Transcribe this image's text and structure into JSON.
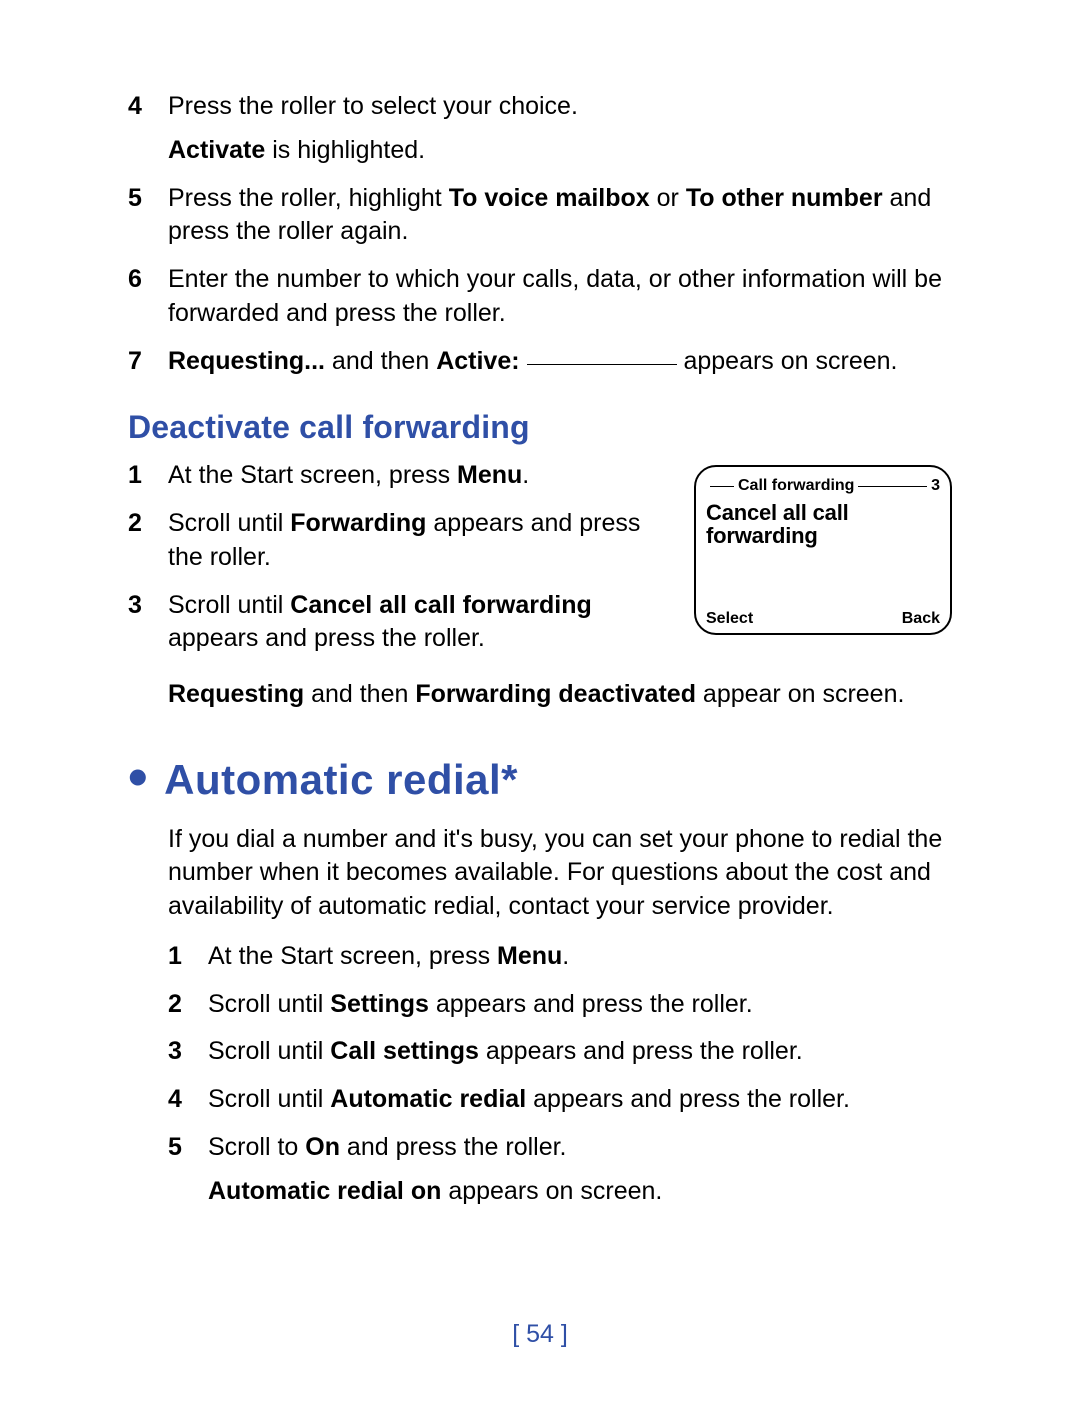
{
  "top_steps": [
    {
      "num": "4",
      "parts": [
        {
          "t": "Press the roller to select your choice."
        },
        {
          "t": "<b>Activate</b> is highlighted."
        }
      ]
    },
    {
      "num": "5",
      "parts": [
        {
          "t": "Press the roller, highlight <b>To voice mailbox</b> or <b>To other number</b> and press the roller again."
        }
      ]
    },
    {
      "num": "6",
      "parts": [
        {
          "t": "Enter the number to which your calls, data, or other information will be forwarded and press the roller."
        }
      ]
    },
    {
      "num": "7",
      "parts": [
        {
          "t": "<b>Requesting...</b> and then <b>Active:</b> <span class=\"blank\"></span> appears on screen."
        }
      ],
      "num_bold": true
    }
  ],
  "deactivate": {
    "heading": "Deactivate call forwarding",
    "steps": [
      {
        "num": "1",
        "parts": [
          {
            "t": "At the Start screen, press <b>Menu</b>."
          }
        ]
      },
      {
        "num": "2",
        "parts": [
          {
            "t": "Scroll until <b>Forwarding</b> appears and press the roller."
          }
        ]
      },
      {
        "num": "3",
        "parts": [
          {
            "t": "Scroll until <b>Cancel all call forwarding</b> appears and press the roller."
          }
        ]
      }
    ],
    "outro": "<b>Requesting</b> and then <b>Forwarding deactivated</b> appear on screen."
  },
  "phone": {
    "header_label": "Call forwarding",
    "header_index": "3",
    "title_line1": "Cancel all call",
    "title_line2": "forwarding",
    "softkey_left": "Select",
    "softkey_right": "Back"
  },
  "auto_redial": {
    "heading": "Automatic redial*",
    "intro": "If you dial a number and it's busy, you can set your phone to redial the number when it becomes available. For questions about the cost and availability of automatic redial, contact your service provider.",
    "steps": [
      {
        "num": "1",
        "parts": [
          {
            "t": "At the Start screen, press <b>Menu</b>."
          }
        ]
      },
      {
        "num": "2",
        "parts": [
          {
            "t": "Scroll until <b>Settings</b> appears and press the roller."
          }
        ]
      },
      {
        "num": "3",
        "parts": [
          {
            "t": "Scroll until <b>Call settings</b> appears and press the roller."
          }
        ]
      },
      {
        "num": "4",
        "parts": [
          {
            "t": "Scroll until <b>Automatic redial</b> appears and press the roller."
          }
        ]
      },
      {
        "num": "5",
        "parts": [
          {
            "t": "Scroll to <b>On</b> and press the roller."
          },
          {
            "t": "<b>Automatic redial on</b> appears on screen."
          }
        ]
      }
    ]
  },
  "page_number": "[ 54 ]"
}
